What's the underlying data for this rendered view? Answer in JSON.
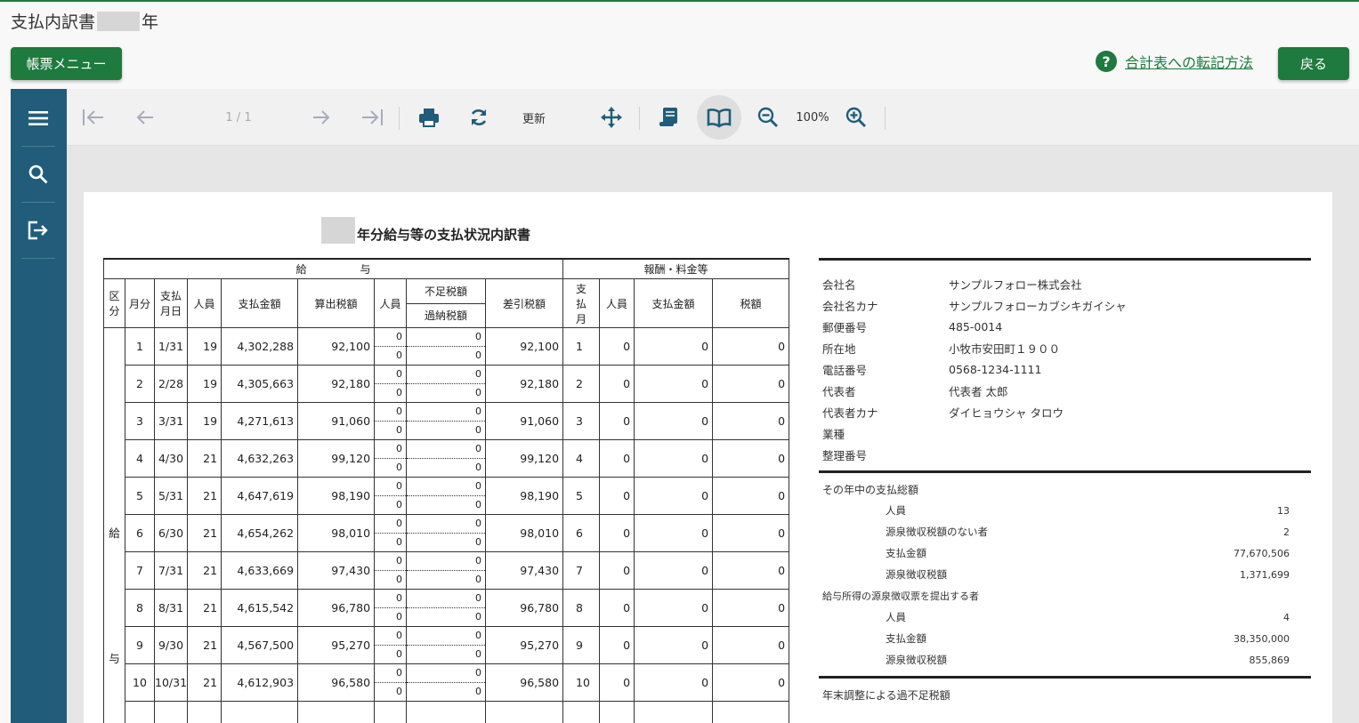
{
  "page": {
    "title_prefix": "支払内訳書",
    "title_suffix": "年"
  },
  "buttons": {
    "report_menu": "帳票メニュー",
    "back": "戻る"
  },
  "help": {
    "icon": "question-circle-icon",
    "link_text": "合計表への転記方法"
  },
  "sidebar": [
    {
      "icon": "menu-icon"
    },
    {
      "icon": "search-icon"
    },
    {
      "icon": "export-icon"
    }
  ],
  "toolbar": {
    "page_indicator": "1 / 1",
    "refresh_label": "更新",
    "zoom": "100%"
  },
  "document": {
    "title": "年分給与等の支払状況内訳書",
    "salary_header": "給　　　　　与",
    "fee_header": "報酬・料金等",
    "col": {
      "kubun": "区分",
      "month": "月分",
      "pay_date": "支払月日",
      "persons": "人員",
      "amount": "支払金額",
      "computed_tax": "算出税額",
      "persons2": "人員",
      "short_tax": "不足税額",
      "over_tax": "過納税額",
      "net_tax": "差引税額",
      "pay_month": "支払月",
      "fee_persons": "人員",
      "fee_amount": "支払金額",
      "fee_tax": "税額"
    },
    "kubun_top": "給",
    "kubun_bottom": "与",
    "rows": [
      {
        "m": "1",
        "d": "1/31",
        "p": "19",
        "amt": "4,302,288",
        "tax": "92,100",
        "a": "0",
        "b": "0",
        "s": "0",
        "o": "0",
        "net": "92,100",
        "pm": "1",
        "fp": "0",
        "fa": "0",
        "ft": "0"
      },
      {
        "m": "2",
        "d": "2/28",
        "p": "19",
        "amt": "4,305,663",
        "tax": "92,180",
        "a": "0",
        "b": "0",
        "s": "0",
        "o": "0",
        "net": "92,180",
        "pm": "2",
        "fp": "0",
        "fa": "0",
        "ft": "0"
      },
      {
        "m": "3",
        "d": "3/31",
        "p": "19",
        "amt": "4,271,613",
        "tax": "91,060",
        "a": "0",
        "b": "0",
        "s": "0",
        "o": "0",
        "net": "91,060",
        "pm": "3",
        "fp": "0",
        "fa": "0",
        "ft": "0"
      },
      {
        "m": "4",
        "d": "4/30",
        "p": "21",
        "amt": "4,632,263",
        "tax": "99,120",
        "a": "0",
        "b": "0",
        "s": "0",
        "o": "0",
        "net": "99,120",
        "pm": "4",
        "fp": "0",
        "fa": "0",
        "ft": "0"
      },
      {
        "m": "5",
        "d": "5/31",
        "p": "21",
        "amt": "4,647,619",
        "tax": "98,190",
        "a": "0",
        "b": "0",
        "s": "0",
        "o": "0",
        "net": "98,190",
        "pm": "5",
        "fp": "0",
        "fa": "0",
        "ft": "0"
      },
      {
        "m": "6",
        "d": "6/30",
        "p": "21",
        "amt": "4,654,262",
        "tax": "98,010",
        "a": "0",
        "b": "0",
        "s": "0",
        "o": "0",
        "net": "98,010",
        "pm": "6",
        "fp": "0",
        "fa": "0",
        "ft": "0"
      },
      {
        "m": "7",
        "d": "7/31",
        "p": "21",
        "amt": "4,633,669",
        "tax": "97,430",
        "a": "0",
        "b": "0",
        "s": "0",
        "o": "0",
        "net": "97,430",
        "pm": "7",
        "fp": "0",
        "fa": "0",
        "ft": "0"
      },
      {
        "m": "8",
        "d": "8/31",
        "p": "21",
        "amt": "4,615,542",
        "tax": "96,780",
        "a": "0",
        "b": "0",
        "s": "0",
        "o": "0",
        "net": "96,780",
        "pm": "8",
        "fp": "0",
        "fa": "0",
        "ft": "0"
      },
      {
        "m": "9",
        "d": "9/30",
        "p": "21",
        "amt": "4,567,500",
        "tax": "95,270",
        "a": "0",
        "b": "0",
        "s": "0",
        "o": "0",
        "net": "95,270",
        "pm": "9",
        "fp": "0",
        "fa": "0",
        "ft": "0"
      },
      {
        "m": "10",
        "d": "10/31",
        "p": "21",
        "amt": "4,612,903",
        "tax": "96,580",
        "a": "0",
        "b": "0",
        "s": "0",
        "o": "0",
        "net": "96,580",
        "pm": "10",
        "fp": "0",
        "fa": "0",
        "ft": "0"
      }
    ],
    "company": [
      {
        "k": "会社名",
        "v": "サンプルフォロー株式会社"
      },
      {
        "k": "会社名カナ",
        "v": "サンプルフォローカブシキガイシャ"
      },
      {
        "k": "郵便番号",
        "v": "485-0014"
      },
      {
        "k": "所在地",
        "v": "小牧市安田町１９００"
      },
      {
        "k": "電話番号",
        "v": "0568-1234-1111"
      },
      {
        "k": "代表者",
        "v": "代表者 太郎"
      },
      {
        "k": "代表者カナ",
        "v": "ダイヒョウシャ タロウ"
      },
      {
        "k": "業種",
        "v": ""
      },
      {
        "k": "整理番号",
        "v": ""
      }
    ],
    "summary_title": "その年中の支払総額",
    "summary": [
      {
        "k": "人員",
        "v": "13"
      },
      {
        "k": "源泉徴収税額のない者",
        "v": "2"
      },
      {
        "k": "支払金額",
        "v": "77,670,506"
      },
      {
        "k": "源泉徴収税額",
        "v": "1,371,699"
      }
    ],
    "submit_title": "給与所得の源泉徴収票を提出する者",
    "submit": [
      {
        "k": "人員",
        "v": "4"
      },
      {
        "k": "支払金額",
        "v": "38,350,000"
      },
      {
        "k": "源泉徴収税額",
        "v": "855,869"
      }
    ],
    "adjust_title": "年末調整による過不足税額"
  }
}
